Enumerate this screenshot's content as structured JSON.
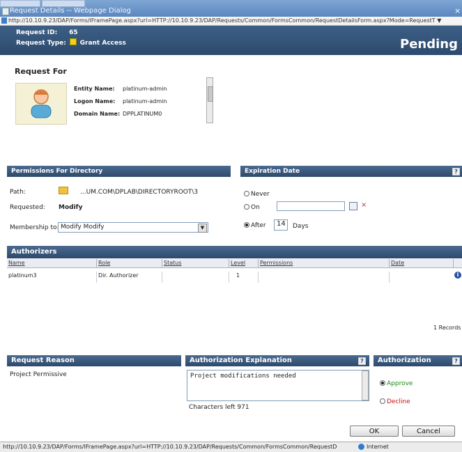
{
  "window": {
    "title": "Request Details -- Webpage Dialog",
    "close": "×",
    "address": "http://10.10.9.23/DAP/Forms/IFramePage.aspx?url=HTTP://10.10.9.23/DAP/Requests/Common/FormsCommon/RequestDetailsForm.aspx?Mode=RequestT ▼"
  },
  "header": {
    "request_id_label": "Request ID:",
    "request_id": "65",
    "request_type_label": "Request Type:",
    "request_type": "Grant Access",
    "status": "Pending"
  },
  "request_for": {
    "title": "Request For",
    "entity_name_label": "Entity Name:",
    "entity_name": "platinum-admin",
    "logon_name_label": "Logon Name:",
    "logon_name": "platinum-admin",
    "domain_name_label": "Domain Name:",
    "domain_name": "DPPLATINUM0"
  },
  "permissions": {
    "title": "Permissions For Directory",
    "path_label": "Path:",
    "path": "...UM.COM\\DPLAB\\DIRECTORYROOT\\3",
    "requested_label": "Requested:",
    "requested": "Modify",
    "membership_label": "Membership to:",
    "membership_value": "Modify   Modify"
  },
  "expiration": {
    "title": "Expiration Date",
    "help": "?",
    "never": "Never",
    "on": "On",
    "after": "After",
    "days_value": "14",
    "days_label": "Days"
  },
  "authorizers": {
    "title": "Authorizers",
    "columns": [
      "Name",
      "Role",
      "Status",
      "Level",
      "Permissions",
      "Date"
    ],
    "rows": [
      {
        "name": "platinum3",
        "role": "Dir. Authorizer",
        "status": "",
        "level": "1",
        "permissions": "",
        "date": ""
      }
    ],
    "records": "1 Records"
  },
  "request_reason": {
    "title": "Request Reason",
    "text": "Project Permissive"
  },
  "authorization_explanation": {
    "title": "Authorization Explanation",
    "help": "?",
    "text": "Project modifications needed",
    "chars_left": "Characters left 971"
  },
  "authorization": {
    "title": "Authorization",
    "help": "?",
    "approve": "Approve",
    "decline": "Decline"
  },
  "buttons": {
    "ok": "OK",
    "cancel": "Cancel"
  },
  "statusbar": {
    "url": "http://10.10.9.23/DAP/Forms/IFramePage.aspx?url=HTTP://10.10.9.23/DAP/Requests/Common/FormsCommon/RequestD",
    "zone": "Internet"
  },
  "colors": {
    "header_bg": "#2c4a6d",
    "approve": "#1a8a1a",
    "decline": "#c01010"
  }
}
